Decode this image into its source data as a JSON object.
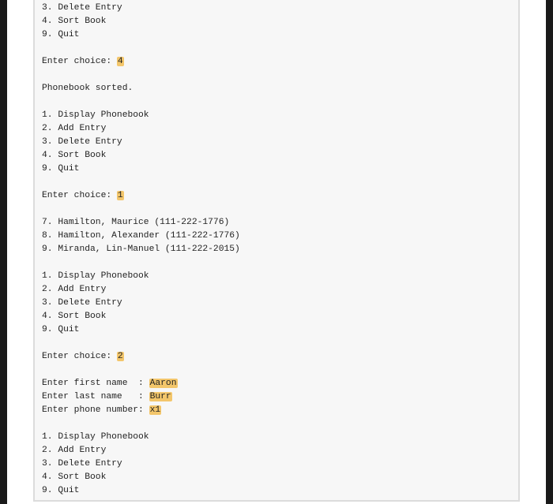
{
  "console": {
    "lines": [
      {
        "text": "3. Delete Entry"
      },
      {
        "text": "4. Sort Book"
      },
      {
        "text": "9. Quit"
      },
      {
        "text": ""
      },
      {
        "text": "Enter choice: ",
        "input": "4"
      },
      {
        "text": ""
      },
      {
        "text": "Phonebook sorted."
      },
      {
        "text": ""
      },
      {
        "text": "1. Display Phonebook"
      },
      {
        "text": "2. Add Entry"
      },
      {
        "text": "3. Delete Entry"
      },
      {
        "text": "4. Sort Book"
      },
      {
        "text": "9. Quit"
      },
      {
        "text": ""
      },
      {
        "text": "Enter choice: ",
        "input": "1"
      },
      {
        "text": ""
      },
      {
        "text": "7. Hamilton, Maurice (111-222-1776)"
      },
      {
        "text": "8. Hamilton, Alexander (111-222-1776)"
      },
      {
        "text": "9. Miranda, Lin-Manuel (111-222-2015)"
      },
      {
        "text": ""
      },
      {
        "text": "1. Display Phonebook"
      },
      {
        "text": "2. Add Entry"
      },
      {
        "text": "3. Delete Entry"
      },
      {
        "text": "4. Sort Book"
      },
      {
        "text": "9. Quit"
      },
      {
        "text": ""
      },
      {
        "text": "Enter choice: ",
        "input": "2"
      },
      {
        "text": ""
      },
      {
        "text": "Enter first name  : ",
        "input": "Aaron"
      },
      {
        "text": "Enter last name   : ",
        "input": "Burr"
      },
      {
        "text": "Enter phone number: ",
        "input": "x1"
      },
      {
        "text": ""
      },
      {
        "text": "1. Display Phonebook"
      },
      {
        "text": "2. Add Entry"
      },
      {
        "text": "3. Delete Entry"
      },
      {
        "text": "4. Sort Book"
      },
      {
        "text": "9. Quit"
      }
    ]
  }
}
